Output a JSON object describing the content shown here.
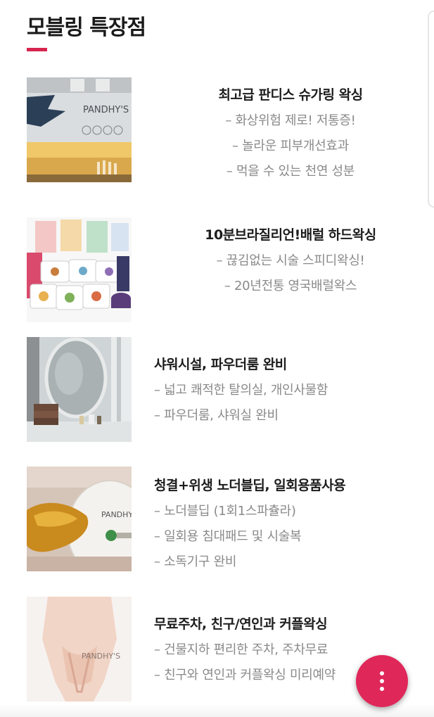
{
  "page": {
    "title": "모블링 특장점"
  },
  "features": [
    {
      "image": "pandhys-shop-sign-photo",
      "heading": "최고급 판디스 슈가링 왁싱",
      "lines": [
        "– 화상위험 제로! 저통증!",
        "– 놀라운 피부개선효과",
        "– 먹을 수 있는 천연 성분"
      ],
      "image_text": "PANDHY'S"
    },
    {
      "image": "wax-products-photo",
      "heading": "10분브라질리언!배럴 하드왁싱",
      "lines": [
        "– 끊김없는 시술 스피디왁싱!",
        "– 20년전통 영국배럴왁스"
      ]
    },
    {
      "image": "shower-room-photo",
      "heading": "샤워시설, 파우더룸 완비",
      "lines": [
        "– 넓고 쾌적한 탈의실, 개인사물함",
        "– 파우더룸, 샤워실 완비"
      ]
    },
    {
      "image": "sugar-paste-jar-photo",
      "heading": "청결+위생 노더블딥, 일회용품사용",
      "lines": [
        "– 노더블딥 (1회1스파츌라)",
        "– 일회용 침대패드 및 시술복",
        "– 소독기구 완비"
      ],
      "image_text": "PANDHY'S"
    },
    {
      "image": "body-model-photo",
      "heading": "무료주차, 친구/연인과  커플왁싱",
      "lines": [
        "– 건물지하 편리한 주차, 주차무료",
        "– 친구와 연인과 커플왁싱 미리예약"
      ],
      "image_text": "PANDHY'S"
    }
  ],
  "fab": {
    "icon": "more-vertical-icon"
  },
  "colors": {
    "accent": "#d6264f",
    "fab": "#e0275a",
    "muted_text": "#8a8a8a"
  }
}
